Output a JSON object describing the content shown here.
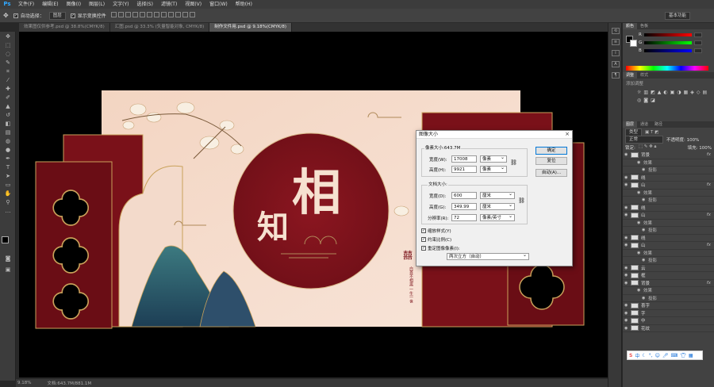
{
  "app": {
    "logo": "Ps"
  },
  "menu": [
    "文件(F)",
    "编辑(E)",
    "图像(I)",
    "图层(L)",
    "文字(Y)",
    "选择(S)",
    "滤镜(T)",
    "视图(V)",
    "窗口(W)",
    "帮助(H)"
  ],
  "options": {
    "auto_select_label": "自动选择：",
    "auto_select_value": "图层",
    "transform_label": "显示变换控件",
    "workspace": "基本功能"
  },
  "tabs": [
    "效果图仅供参考.psd @ 38.8%(CMYK/8)",
    "汇图.psd @ 33.3% (矢量智能对象, CMYK/8)",
    "制作文件用.psd @ 9.18%(CMYK/8)"
  ],
  "status": {
    "zoom": "9.18%",
    "doc": "文档:643.7M/881.1M"
  },
  "artwork": {
    "char1": "相",
    "char2": "知",
    "seal": "囍",
    "poem": "白首不相离 一生一世"
  },
  "color_panel": {
    "tabs": [
      "颜色",
      "色板"
    ],
    "r": "R",
    "g": "G",
    "b": "B"
  },
  "adjust_panel": {
    "tabs": [
      "调整",
      "样式"
    ],
    "add_label": "添加调整"
  },
  "layers_panel": {
    "tabs": [
      "图层",
      "通道",
      "路径"
    ],
    "kind_label": "类型",
    "blend": "正常",
    "opacity": "不透明度: 100%",
    "lock_label": "锁定:",
    "fill": "填充: 100%",
    "layers": [
      {
        "name": "背景",
        "kind": "layer",
        "fx": "fx"
      },
      {
        "name": "效果",
        "kind": "sub"
      },
      {
        "name": "投影",
        "kind": "sub2"
      },
      {
        "name": "线",
        "kind": "layer"
      },
      {
        "name": "山",
        "kind": "layer",
        "fx": "fx"
      },
      {
        "name": "效果",
        "kind": "sub"
      },
      {
        "name": "投影",
        "kind": "sub2"
      },
      {
        "name": "线",
        "kind": "layer"
      },
      {
        "name": "山",
        "kind": "layer",
        "fx": "fx"
      },
      {
        "name": "效果",
        "kind": "sub"
      },
      {
        "name": "投影",
        "kind": "sub2"
      },
      {
        "name": "线",
        "kind": "layer"
      },
      {
        "name": "山",
        "kind": "layer",
        "fx": "fx"
      },
      {
        "name": "效果",
        "kind": "sub"
      },
      {
        "name": "投影",
        "kind": "sub2"
      },
      {
        "name": "云",
        "kind": "layer"
      },
      {
        "name": "框",
        "kind": "layer"
      },
      {
        "name": "背景",
        "kind": "layer",
        "fx": "fx"
      },
      {
        "name": "效果",
        "kind": "sub"
      },
      {
        "name": "投影",
        "kind": "sub2"
      },
      {
        "name": "喜字",
        "kind": "layer"
      },
      {
        "name": "字",
        "kind": "layer"
      },
      {
        "name": "中",
        "kind": "layer"
      },
      {
        "name": "花纹",
        "kind": "layer"
      }
    ]
  },
  "ime": {
    "label": "中"
  },
  "dialog": {
    "title": "图像大小",
    "close": "×",
    "pixel_dims": "像素大小:643.7M",
    "width_label": "宽度(W):",
    "width_value": "17008",
    "width_unit": "像素",
    "height_label": "高度(H):",
    "height_value": "9921",
    "height_unit": "像素",
    "doc_size": "文档大小:",
    "doc_width_label": "宽度(D):",
    "doc_width_value": "600",
    "doc_width_unit": "厘米",
    "doc_height_label": "高度(G):",
    "doc_height_value": "349.99",
    "doc_height_unit": "厘米",
    "res_label": "分辨率(R):",
    "res_value": "72",
    "res_unit": "像素/英寸",
    "scale_styles": "缩放样式(Y)",
    "constrain": "约束比例(C)",
    "resample": "重定图像像素(I):",
    "resample_method": "两次立方（自动）",
    "ok": "确定",
    "reset": "复位",
    "auto": "自动(A)..."
  }
}
